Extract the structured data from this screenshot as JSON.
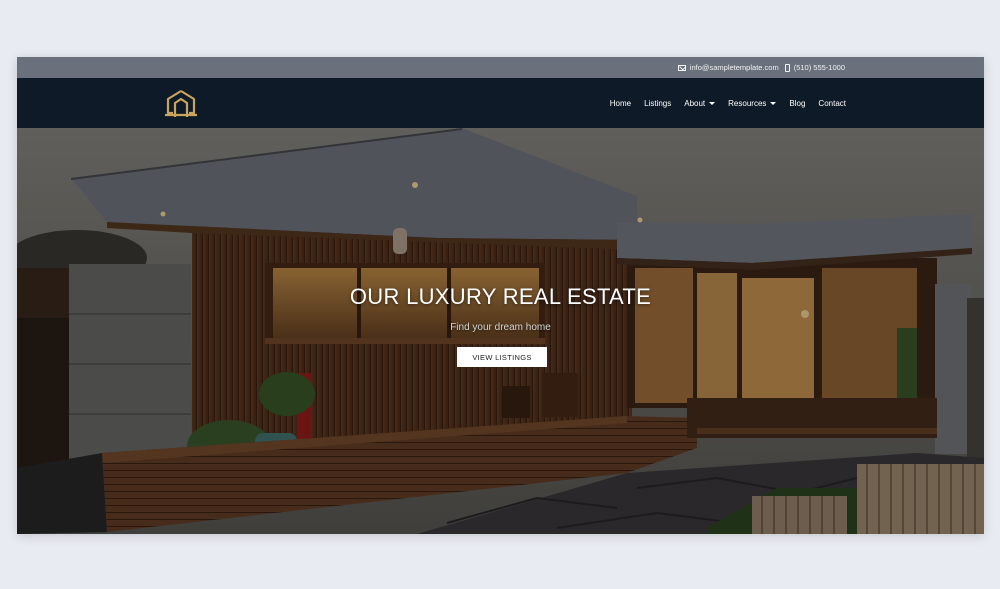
{
  "topbar": {
    "email": "info@sampletemplate.com",
    "phone": "(510) 555-1000",
    "icons": [
      "envelope-icon",
      "phone-icon"
    ]
  },
  "navbar": {
    "logo": "house-logo-icon",
    "items": [
      {
        "label": "Home"
      },
      {
        "label": "Listings"
      },
      {
        "label": "About",
        "dropdown": true
      },
      {
        "label": "Resources",
        "dropdown": true
      },
      {
        "label": "Blog"
      },
      {
        "label": "Contact"
      }
    ]
  },
  "hero": {
    "title": "OUR LUXURY REAL ESTATE",
    "subtitle": "Find your dream home",
    "button": "VIEW LISTINGS"
  },
  "colors": {
    "page_background": "#e8ebf2",
    "topbar": "#6a717c",
    "navbar": "#0f1a28",
    "logo_gold": "#c9a45c",
    "button": "#ffffff"
  }
}
